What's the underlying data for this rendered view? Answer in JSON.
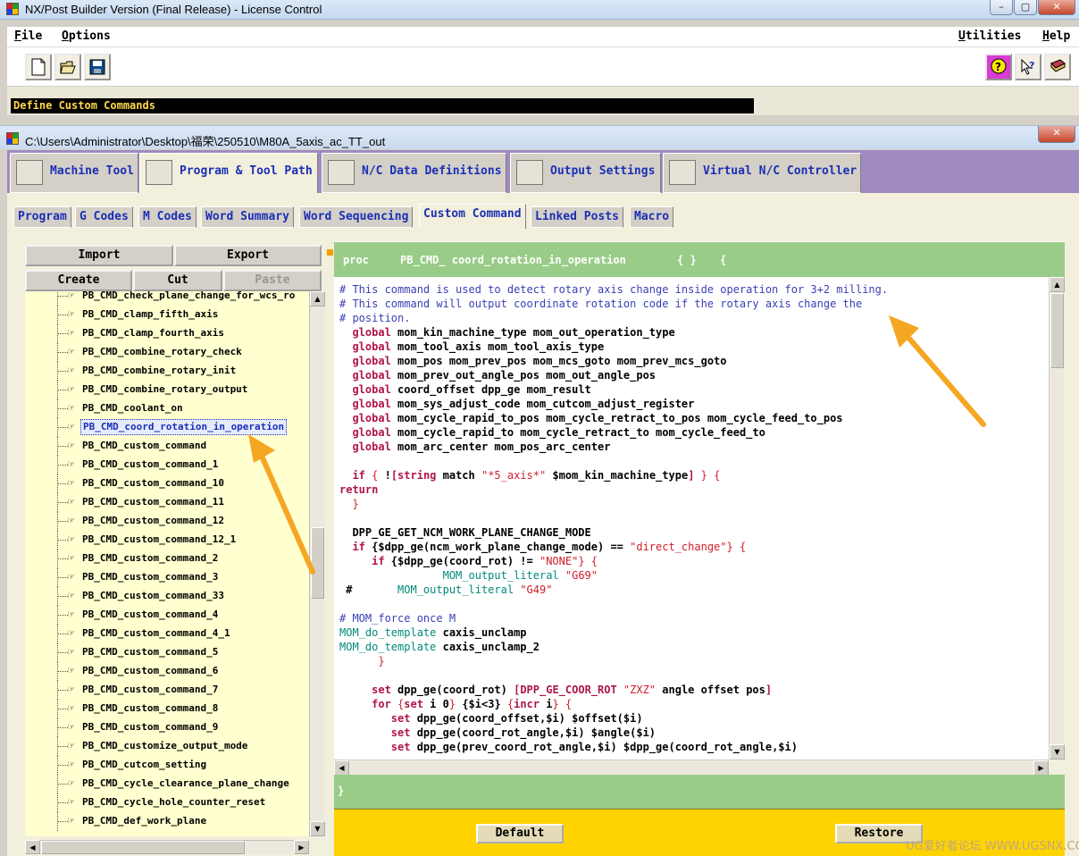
{
  "app": {
    "title": "NX/Post Builder Version (Final Release) - License Control",
    "window_controls": [
      "–",
      "▢",
      "✕"
    ]
  },
  "menu": {
    "file": "File",
    "options": "Options",
    "utilities": "Utilities",
    "help": "Help"
  },
  "toolbar": {
    "new_icon": "new-file-icon",
    "open_icon": "open-folder-icon",
    "save_icon": "save-disk-icon",
    "context_help_icon": "context-help-icon",
    "whats_this_icon": "whats-this-icon",
    "manual_icon": "manual-book-icon"
  },
  "status": "Define Custom Commands",
  "inner_window": {
    "title": "C:\\Users\\Administrator\\Desktop\\福荣\\250510\\M80A_5axis_ac_TT_out",
    "close": "✕"
  },
  "main_tabs": [
    {
      "label": "Machine Tool",
      "active": false
    },
    {
      "label": "Program & Tool Path",
      "active": true
    },
    {
      "label": "N/C Data Definitions",
      "active": false
    },
    {
      "label": "Output Settings",
      "active": false
    },
    {
      "label": "Virtual N/C Controller",
      "active": false
    }
  ],
  "sub_tabs": [
    {
      "label": "Program",
      "active": false
    },
    {
      "label": "G Codes",
      "active": false
    },
    {
      "label": "M Codes",
      "active": false
    },
    {
      "label": "Word Summary",
      "active": false
    },
    {
      "label": "Word Sequencing",
      "active": false
    },
    {
      "label": "Custom Command",
      "active": true
    },
    {
      "label": "Linked Posts",
      "active": false
    },
    {
      "label": "Macro",
      "active": false
    }
  ],
  "left_panel": {
    "import": "Import",
    "export": "Export",
    "create": "Create",
    "cut": "Cut",
    "paste": "Paste",
    "tree_items": [
      "PB_CMD_check_plane_change_for_wcs_ro",
      "PB_CMD_clamp_fifth_axis",
      "PB_CMD_clamp_fourth_axis",
      "PB_CMD_combine_rotary_check",
      "PB_CMD_combine_rotary_init",
      "PB_CMD_combine_rotary_output",
      "PB_CMD_coolant_on",
      "PB_CMD_coord_rotation_in_operation",
      "PB_CMD_custom_command",
      "PB_CMD_custom_command_1",
      "PB_CMD_custom_command_10",
      "PB_CMD_custom_command_11",
      "PB_CMD_custom_command_12",
      "PB_CMD_custom_command_12_1",
      "PB_CMD_custom_command_2",
      "PB_CMD_custom_command_3",
      "PB_CMD_custom_command_33",
      "PB_CMD_custom_command_4",
      "PB_CMD_custom_command_4_1",
      "PB_CMD_custom_command_5",
      "PB_CMD_custom_command_6",
      "PB_CMD_custom_command_7",
      "PB_CMD_custom_command_8",
      "PB_CMD_custom_command_9",
      "PB_CMD_customize_output_mode",
      "PB_CMD_cutcom_setting",
      "PB_CMD_cycle_clearance_plane_change",
      "PB_CMD_cycle_hole_counter_reset",
      "PB_CMD_def_work_plane"
    ],
    "selected_item": "PB_CMD_coord_rotation_in_operation"
  },
  "proc_header": {
    "keyword": "proc",
    "name": "PB_CMD_ coord_rotation_in_operation",
    "args": "{ }",
    "open_brace": "{"
  },
  "code_lines": [
    {
      "segs": [
        [
          "cm",
          "# This command is used to detect rotary axis change inside operation for 3+2 milling."
        ]
      ]
    },
    {
      "segs": [
        [
          "cm",
          "# This command will output coordinate rotation code if the rotary axis change the"
        ]
      ]
    },
    {
      "segs": [
        [
          "cm",
          "# position."
        ]
      ]
    },
    {
      "segs": [
        [
          "",
          "  "
        ],
        [
          "kw",
          "global"
        ],
        [
          "id",
          " mom_kin_machine_type mom_out_operation_type"
        ]
      ]
    },
    {
      "segs": [
        [
          "",
          "  "
        ],
        [
          "kw",
          "global"
        ],
        [
          "id",
          " mom_tool_axis mom_tool_axis_type"
        ]
      ]
    },
    {
      "segs": [
        [
          "",
          "  "
        ],
        [
          "kw",
          "global"
        ],
        [
          "id",
          " mom_pos mom_prev_pos mom_mcs_goto mom_prev_mcs_goto"
        ]
      ]
    },
    {
      "segs": [
        [
          "",
          "  "
        ],
        [
          "kw",
          "global"
        ],
        [
          "id",
          " mom_prev_out_angle_pos mom_out_angle_pos"
        ]
      ]
    },
    {
      "segs": [
        [
          "",
          "  "
        ],
        [
          "kw",
          "global"
        ],
        [
          "id",
          " coord_offset dpp_ge mom_result"
        ]
      ]
    },
    {
      "segs": [
        [
          "",
          "  "
        ],
        [
          "kw",
          "global"
        ],
        [
          "id",
          " mom_sys_adjust_code mom_cutcom_adjust_register"
        ]
      ]
    },
    {
      "segs": [
        [
          "",
          "  "
        ],
        [
          "kw",
          "global"
        ],
        [
          "id",
          " mom_cycle_rapid_to_pos mom_cycle_retract_to_pos mom_cycle_feed_to_pos"
        ]
      ]
    },
    {
      "segs": [
        [
          "",
          "  "
        ],
        [
          "kw",
          "global"
        ],
        [
          "id",
          " mom_cycle_rapid_to mom_cycle_retract_to mom_cycle_feed_to"
        ]
      ]
    },
    {
      "segs": [
        [
          "",
          "  "
        ],
        [
          "kw",
          "global"
        ],
        [
          "id",
          " mom_arc_center mom_pos_arc_center"
        ]
      ]
    },
    {
      "segs": [
        [
          "",
          ""
        ]
      ]
    },
    {
      "segs": [
        [
          "",
          "  "
        ],
        [
          "kw",
          "if"
        ],
        [
          "st",
          " { "
        ],
        [
          "id",
          "!"
        ],
        [
          "kw",
          "[string"
        ],
        [
          "id",
          " match "
        ],
        [
          "st",
          "\"*5_axis*\""
        ],
        [
          "id",
          " $mom_kin_machine_type"
        ],
        [
          "kw",
          "]"
        ],
        [
          "st",
          " } {"
        ]
      ]
    },
    {
      "segs": [
        [
          "kw",
          "return"
        ]
      ]
    },
    {
      "segs": [
        [
          "st",
          "  }"
        ]
      ]
    },
    {
      "segs": [
        [
          "",
          ""
        ]
      ]
    },
    {
      "segs": [
        [
          "id",
          "  DPP_GE_GET_NCM_WORK_PLANE_CHANGE_MODE"
        ]
      ]
    },
    {
      "segs": [
        [
          "",
          "  "
        ],
        [
          "kw",
          "if"
        ],
        [
          "id",
          " {$dpp_ge(ncm_work_plane_change_mode) == "
        ],
        [
          "st",
          "\"direct_change\""
        ],
        [
          "st",
          "} {"
        ]
      ]
    },
    {
      "segs": [
        [
          "",
          "     "
        ],
        [
          "kw",
          "if"
        ],
        [
          "id",
          " {$dpp_ge(coord_rot) != "
        ],
        [
          "st",
          "\"NONE\""
        ],
        [
          "st",
          "} {"
        ]
      ]
    },
    {
      "segs": [
        [
          "",
          "                "
        ],
        [
          "mg",
          "MOM_output_literal"
        ],
        [
          "st",
          " \"G69\""
        ]
      ]
    },
    {
      "segs": [
        [
          "id",
          " #       "
        ],
        [
          "mg",
          "MOM_output_literal"
        ],
        [
          "st",
          " \"G49\""
        ]
      ]
    },
    {
      "segs": [
        [
          "",
          ""
        ]
      ]
    },
    {
      "segs": [
        [
          "cm",
          "# MOM_force once M"
        ]
      ]
    },
    {
      "segs": [
        [
          "mg",
          "MOM_do_template"
        ],
        [
          "id",
          " caxis_unclamp"
        ]
      ]
    },
    {
      "segs": [
        [
          "mg",
          "MOM_do_template"
        ],
        [
          "id",
          " caxis_unclamp_2"
        ]
      ]
    },
    {
      "segs": [
        [
          "st",
          "      }"
        ]
      ]
    },
    {
      "segs": [
        [
          "",
          ""
        ]
      ]
    },
    {
      "segs": [
        [
          "",
          "     "
        ],
        [
          "kw",
          "set"
        ],
        [
          "id",
          " dpp_ge(coord_rot) "
        ],
        [
          "kw",
          "[DPP_GE_COOR_ROT"
        ],
        [
          "st",
          " \"ZXZ\""
        ],
        [
          "id",
          " angle offset pos"
        ],
        [
          "kw",
          "]"
        ]
      ]
    },
    {
      "segs": [
        [
          "",
          "     "
        ],
        [
          "kw",
          "for"
        ],
        [
          "st",
          " {"
        ],
        [
          "kw",
          "set"
        ],
        [
          "id",
          " i 0"
        ],
        [
          "st",
          "}"
        ],
        [
          "id",
          " {$i<3} "
        ],
        [
          "st",
          "{"
        ],
        [
          "kw",
          "incr"
        ],
        [
          "id",
          " i"
        ],
        [
          "st",
          "} {"
        ]
      ]
    },
    {
      "segs": [
        [
          "",
          "        "
        ],
        [
          "kw",
          "set"
        ],
        [
          "id",
          " dpp_ge(coord_offset,$i) $offset($i)"
        ]
      ]
    },
    {
      "segs": [
        [
          "",
          "        "
        ],
        [
          "kw",
          "set"
        ],
        [
          "id",
          " dpp_ge(coord_rot_angle,$i) $angle($i)"
        ]
      ]
    },
    {
      "segs": [
        [
          "",
          "        "
        ],
        [
          "kw",
          "set"
        ],
        [
          "id",
          " dpp_ge(prev_coord_rot_angle,$i) $dpp_ge(coord_rot_angle,$i)"
        ]
      ]
    }
  ],
  "proc_footer": "}",
  "actions": {
    "default": "Default",
    "restore": "Restore"
  },
  "watermark": "UG爱好者论坛 WWW.UGSNX.COM",
  "colors": {
    "title_bar": "#c6d8ef",
    "tab_strip": "#a08ac0",
    "panel_bg": "#f2efdc",
    "tree_bg": "#ffffd0",
    "proc_band": "#99cc88",
    "action_bar": "#ffd300",
    "comment": "#3a3fb4",
    "keyword": "#b0154a",
    "mom_call": "#00897a",
    "string": "#d0202a",
    "annotation_arrow": "#f5a623"
  }
}
